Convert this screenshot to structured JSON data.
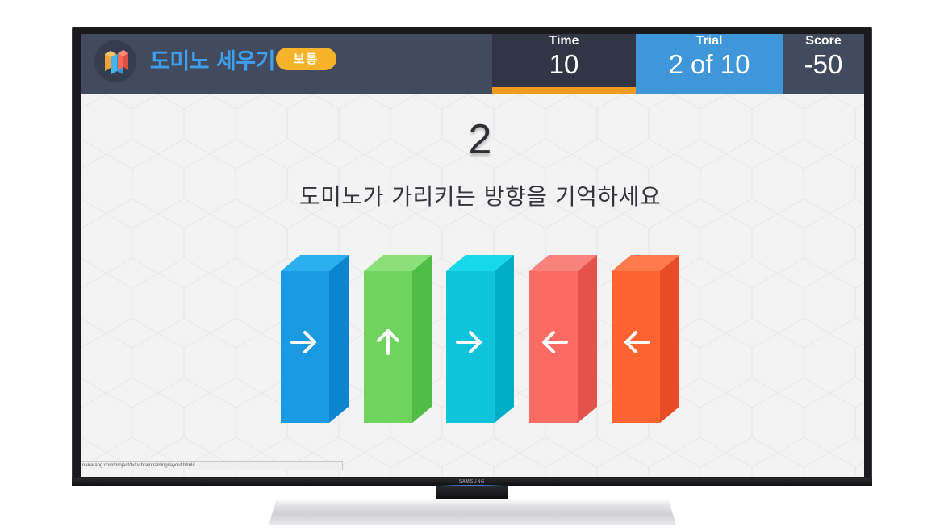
{
  "header": {
    "logo_icon": "domino-blocks-icon",
    "title": "도미노 세우기",
    "level": "보통",
    "time": {
      "label": "Time",
      "value": "10",
      "progress": 1.0,
      "progress_color": "#f09a1f"
    },
    "trial": {
      "label": "Trial",
      "value": "2 of 10"
    },
    "score": {
      "label": "Score",
      "value": "-50"
    }
  },
  "main": {
    "countdown": "2",
    "instruction": "도미노가 가리키는 방향을 기억하세요",
    "dominoes": [
      {
        "color": "blue",
        "front": "#1a9ae0",
        "side": "#0a86cf",
        "top": "#2bb0ef",
        "direction": "right",
        "icon": "arrow-right-icon"
      },
      {
        "color": "green",
        "front": "#6fd35e",
        "side": "#4fbd46",
        "top": "#8be07a",
        "direction": "up",
        "icon": "arrow-up-icon"
      },
      {
        "color": "cyan",
        "front": "#0fc3dd",
        "side": "#00adc8",
        "top": "#17d7ea",
        "direction": "right",
        "icon": "arrow-right-icon"
      },
      {
        "color": "salmon",
        "front": "#fb6b63",
        "side": "#e4524c",
        "top": "#f8837c",
        "direction": "left",
        "icon": "arrow-left-icon"
      },
      {
        "color": "orange",
        "front": "#ff6332",
        "side": "#e74c27",
        "top": "#ff7a4c",
        "direction": "left",
        "icon": "arrow-left-icon"
      }
    ]
  },
  "status_bar": {
    "url": "nairarang.com/project/tv/tv-braintraining/layout.html#"
  },
  "device": {
    "brand": "SAMSUNG"
  }
}
